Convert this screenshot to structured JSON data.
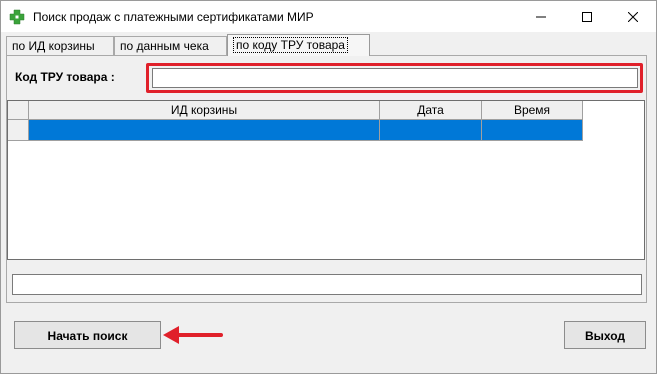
{
  "window": {
    "title": "Поиск продаж с платежными сертификатами МИР",
    "icon": "green-cross-icon",
    "controls": {
      "minimize": "minimize-icon",
      "maximize": "maximize-icon",
      "close": "close-icon"
    }
  },
  "tabs": [
    {
      "label": "по ИД корзины",
      "active": false
    },
    {
      "label": "по данным чека",
      "active": false
    },
    {
      "label": "по коду ТРУ товара",
      "active": true
    }
  ],
  "form": {
    "code_label": "Код ТРУ товара :",
    "code_value": ""
  },
  "grid": {
    "columns": [
      "ИД корзины",
      "Дата",
      "Время"
    ],
    "rows": [
      {
        "basket_id": "",
        "date": "",
        "time": "",
        "selected": true
      }
    ]
  },
  "status": {
    "text": ""
  },
  "buttons": {
    "search_label": "Начать поиск",
    "exit_label": "Выход"
  },
  "colors": {
    "highlight_border": "#e0202a",
    "selected_row": "#0078d7",
    "arrow": "#e0202a",
    "icon_green": "#3aa33a"
  }
}
